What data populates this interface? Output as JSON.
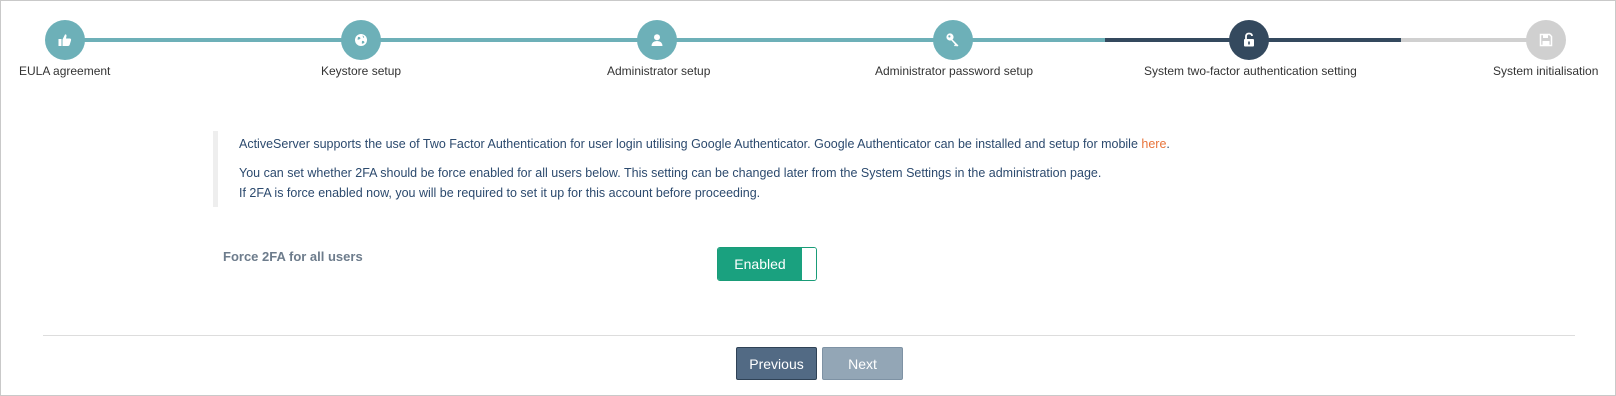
{
  "stepper": {
    "steps": [
      {
        "label": "EULA agreement",
        "state": "done",
        "icon": "thumbs-up-icon"
      },
      {
        "label": "Keystore setup",
        "state": "done",
        "icon": "globe-icon"
      },
      {
        "label": "Administrator setup",
        "state": "done",
        "icon": "user-icon"
      },
      {
        "label": "Administrator password setup",
        "state": "done",
        "icon": "key-icon"
      },
      {
        "label": "System two-factor authentication setting",
        "state": "current",
        "icon": "unlock-icon"
      },
      {
        "label": "System initialisation",
        "state": "todo",
        "icon": "floppy-disk-icon"
      }
    ]
  },
  "info": {
    "line1_text": "ActiveServer supports the use of Two Factor Authentication for user login utilising Google Authenticator. Google Authenticator can be installed and setup for mobile ",
    "line1_link": "here",
    "line1_end": ".",
    "line2": "You can set whether 2FA should be force enabled for all users below. This setting can be changed later from the System Settings in the administration page.",
    "line3": "If 2FA is force enabled now, you will be required to set it up for this account before proceeding."
  },
  "setting": {
    "label": "Force 2FA for all users",
    "toggle_label": "Enabled",
    "toggle_on": true
  },
  "footer": {
    "previous_label": "Previous",
    "next_label": "Next"
  },
  "colors": {
    "done": "#6db0b8",
    "current": "#34495e",
    "todo": "#d0d0d0",
    "toggle_on": "#1aa17f",
    "link": "#e8743b"
  }
}
